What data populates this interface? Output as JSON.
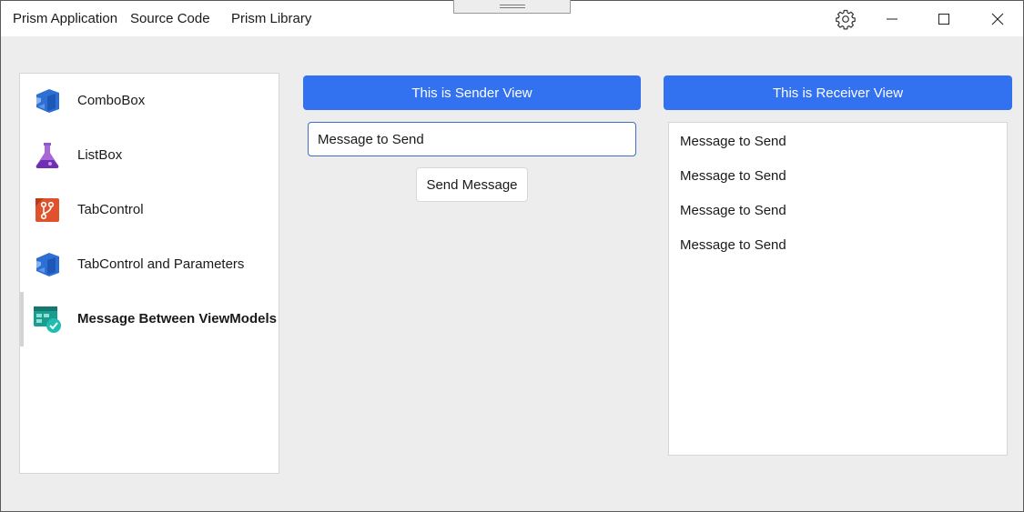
{
  "titlebar": {
    "menu": [
      "Prism Application",
      "Source Code",
      "Prism Library"
    ],
    "icons": {
      "settings": "gear-icon",
      "minimize": "minimize-icon",
      "maximize": "maximize-icon",
      "close": "close-icon"
    }
  },
  "nav": {
    "items": [
      {
        "label": "ComboBox",
        "icon": "azure-devops-icon",
        "selected": false
      },
      {
        "label": "ListBox",
        "icon": "flask-icon",
        "selected": false
      },
      {
        "label": "TabControl",
        "icon": "repo-branch-icon",
        "selected": false
      },
      {
        "label": "TabControl and Parameters",
        "icon": "azure-devops-icon",
        "selected": false
      },
      {
        "label": "Message Between ViewModels",
        "icon": "board-check-icon",
        "selected": true
      }
    ]
  },
  "sender": {
    "header": "This is Sender View",
    "input_value": "Message to Send",
    "button_label": "Send Message"
  },
  "receiver": {
    "header": "This is Receiver View",
    "messages": [
      "Message to Send",
      "Message to Send",
      "Message to Send",
      "Message to Send"
    ]
  },
  "colors": {
    "accent": "#3271f0",
    "background": "#ededed",
    "panel": "#ffffff"
  }
}
